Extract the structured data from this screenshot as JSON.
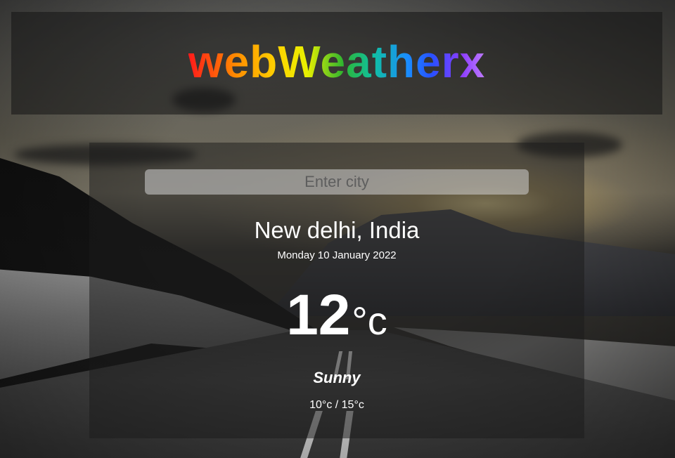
{
  "app": {
    "logo_text": "webWeatherx"
  },
  "search": {
    "placeholder": "Enter city",
    "value": ""
  },
  "weather": {
    "location": "New delhi, India",
    "date": "Monday 10 January 2022",
    "temperature": "12",
    "unit": "°c",
    "condition": "Sunny",
    "range": "10°c / 15°c"
  },
  "colors": {
    "logo_gradient": [
      "#ff1a1a",
      "#ff8c00",
      "#ffd400",
      "#2fb52f",
      "#10c0a0",
      "#1a8cff",
      "#2850ff",
      "#8b3cff",
      "#c07cff"
    ],
    "text": "#ffffff",
    "panel": "rgba(25,25,25,0.5)"
  }
}
